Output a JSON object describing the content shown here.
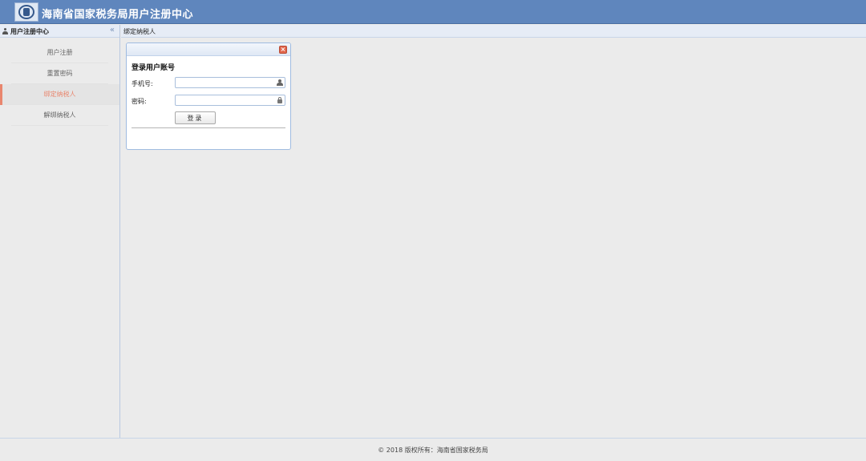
{
  "header": {
    "site_title": "海南省国家税务局用户注册中心",
    "brand_color": "#5f86bd"
  },
  "sidebar": {
    "title": "用户注册中心",
    "collapse_icon": "«",
    "items": [
      {
        "label": "用户注册",
        "active": false
      },
      {
        "label": "重置密码",
        "active": false
      },
      {
        "label": "绑定纳税人",
        "active": true
      },
      {
        "label": "解绑纳税人",
        "active": false
      }
    ],
    "active_color": "#e9866e"
  },
  "main": {
    "panel_title": "绑定纳税人"
  },
  "dialog": {
    "close_icon": "×",
    "title": "登录用户账号",
    "phone_label": "手机号:",
    "phone_value": "",
    "password_label": "密码:",
    "password_value": "",
    "login_label": "登录"
  },
  "footer": {
    "text": "© 2018 版权所有：海南省国家税务局"
  }
}
